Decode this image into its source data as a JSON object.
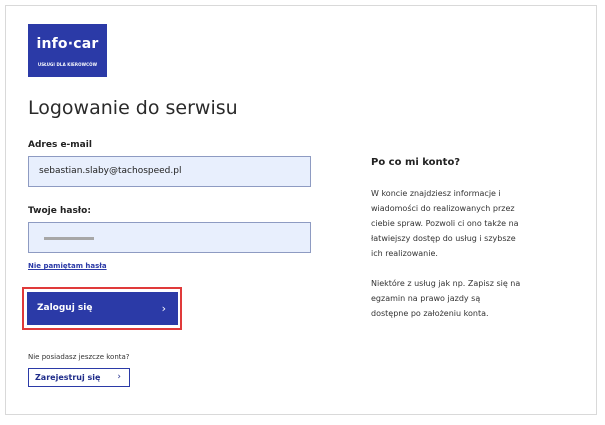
{
  "logo": {
    "main": "info·car",
    "sub": "USŁUGI DLA KIEROWCÓW"
  },
  "page_title": "Logowanie do serwisu",
  "form": {
    "email_label": "Adres e-mail",
    "email_value": "sebastian.slaby@tachospeed.pl",
    "password_label": "Twoje hasło:",
    "forgot_link": "Nie pamiętam hasła",
    "login_button": "Zaloguj się",
    "no_account_text": "Nie posiadasz jeszcze konta?",
    "register_button": "Zarejestruj się"
  },
  "info": {
    "title": "Po co mi konto?",
    "paragraph1": "W koncie znajdziesz informacje i\nwiadomości do realizowanych przez\nciebie spraw. Pozwoli ci ono także na\nłatwiejszy dostęp do usług i szybsze\nich realizowanie.",
    "paragraph2": "Niektóre z usług jak np. Zapisz się na\negzamin na prawo jazdy są\ndostępne po założeniu konta."
  },
  "icons": {
    "login_chevron": "chevron-right-icon",
    "register_chevron": "chevron-right-icon"
  },
  "colors": {
    "brand": "#2b3aa7",
    "field_bg": "#e8effd",
    "highlight": "#e03a3a"
  }
}
